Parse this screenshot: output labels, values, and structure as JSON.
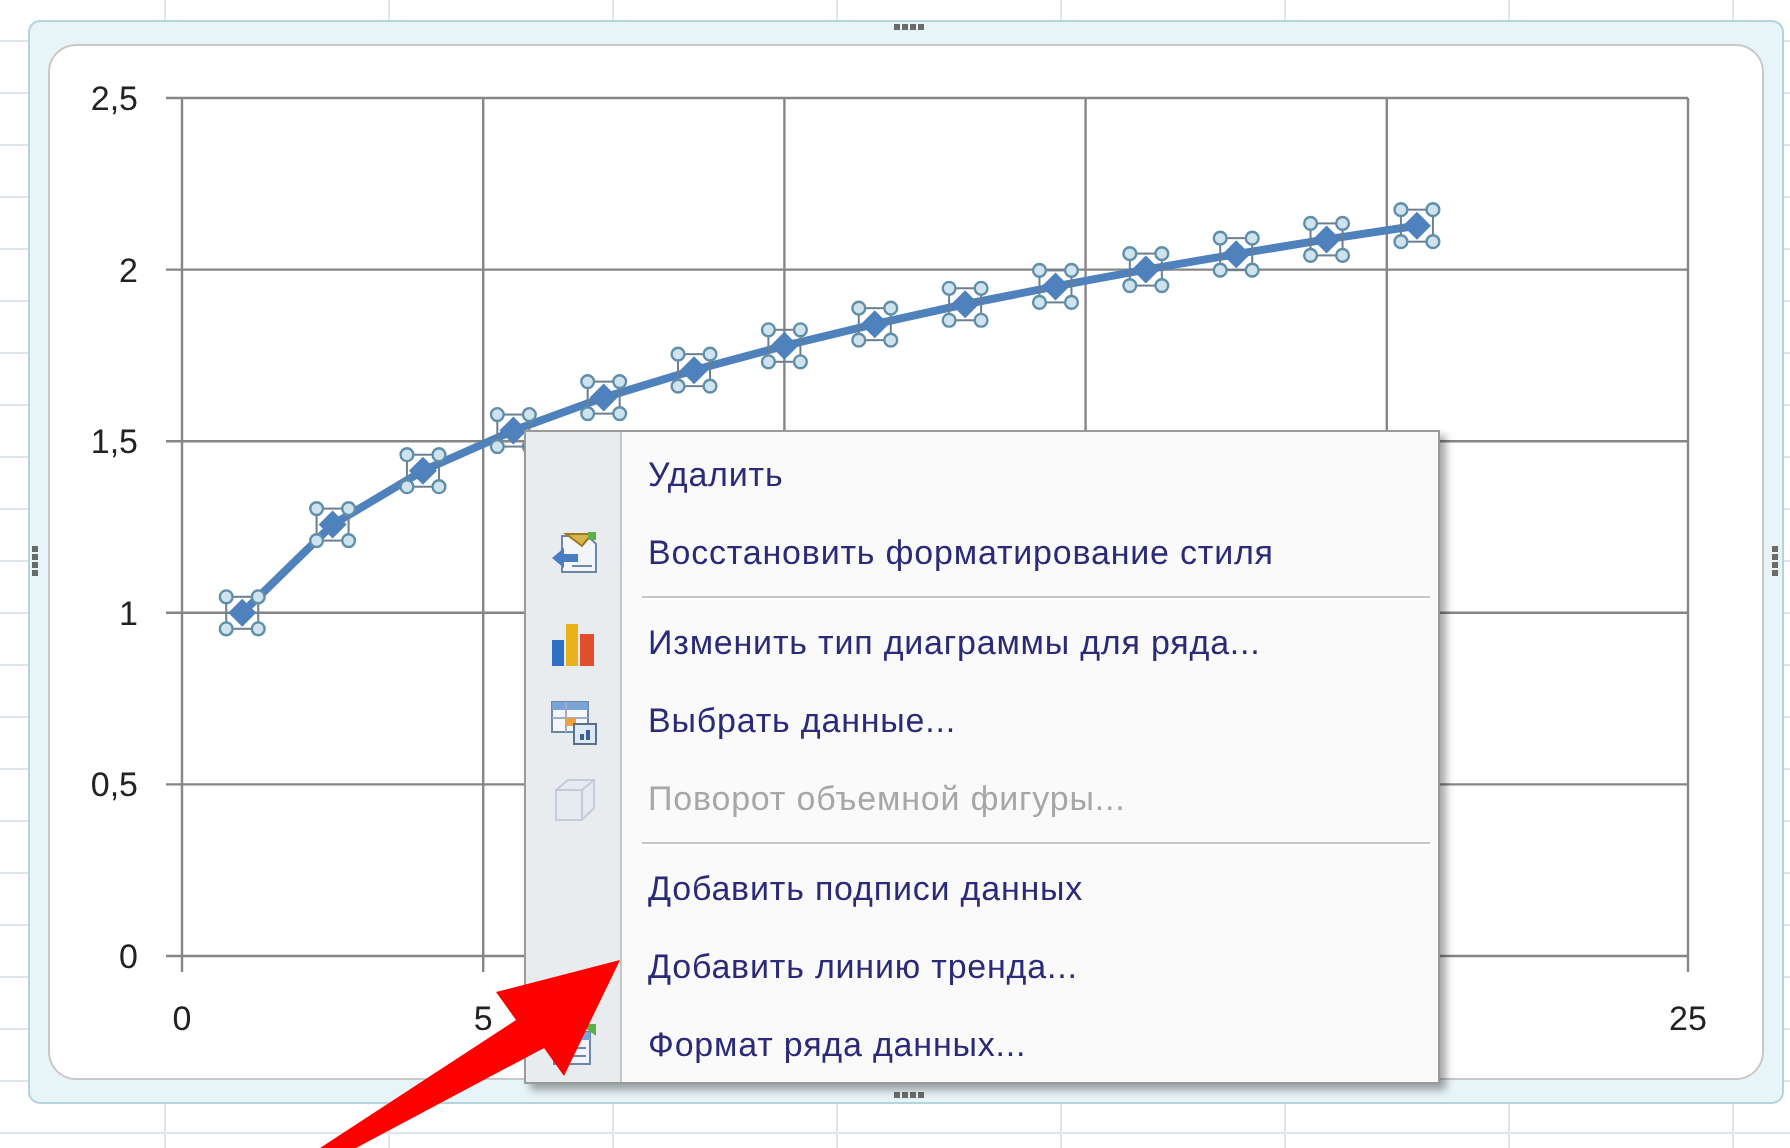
{
  "chart": {
    "series_selected": true,
    "chart_data": {
      "type": "line",
      "x": [
        1,
        2.5,
        4,
        5.5,
        7,
        8.5,
        10,
        11.5,
        13,
        14.5,
        16,
        17.5,
        19,
        20.5
      ],
      "grid": true,
      "series": [
        {
          "color": "#4f81bd",
          "marker": "diamond",
          "values": [
            1,
            1.257,
            1.414,
            1.531,
            1.627,
            1.707,
            1.778,
            1.841,
            1.899,
            1.951,
            2,
            2.045,
            2.088,
            2.128
          ]
        }
      ],
      "xlim": [
        0,
        25
      ],
      "ylim": [
        0,
        2.5
      ],
      "xticks": [
        0,
        5,
        25
      ],
      "yticks": [
        {
          "value": 0,
          "label": "0"
        },
        {
          "value": 0.5,
          "label": "0,5"
        },
        {
          "value": 1,
          "label": "1"
        },
        {
          "value": 1.5,
          "label": "1,5"
        },
        {
          "value": 2,
          "label": "2"
        },
        {
          "value": 2.5,
          "label": "2,5"
        }
      ]
    }
  },
  "context_menu": {
    "sections": [
      {
        "items": [
          {
            "label": "Удалить",
            "disabled": false
          },
          {
            "label": "Восстановить форматирование стиля",
            "disabled": false
          }
        ]
      },
      {
        "items": [
          {
            "label": "Изменить тип диаграммы для ряда...",
            "disabled": false
          },
          {
            "label": "Выбрать данные...",
            "disabled": false
          },
          {
            "label": "Поворот объемной фигуры...",
            "disabled": true
          }
        ]
      },
      {
        "items": [
          {
            "label": "Добавить подписи данных",
            "disabled": false
          },
          {
            "label": "Добавить линию тренда...",
            "disabled": false
          },
          {
            "label": "Формат ряда данных...",
            "disabled": false
          }
        ]
      }
    ]
  }
}
